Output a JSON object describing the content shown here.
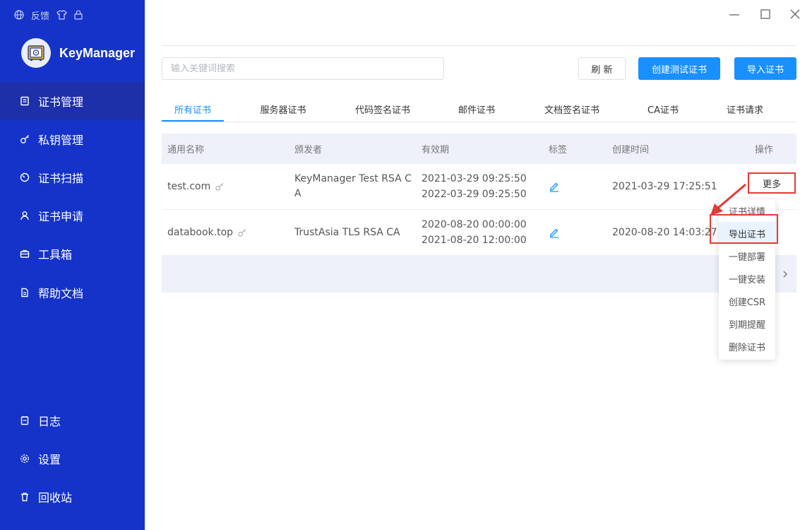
{
  "header": {
    "feedback_label": "反馈",
    "app_name": "KeyManager"
  },
  "sidebar": {
    "items": [
      {
        "label": "证书管理",
        "icon": "certificate-icon",
        "active": true
      },
      {
        "label": "私钥管理",
        "icon": "key-icon"
      },
      {
        "label": "证书扫描",
        "icon": "scan-icon"
      },
      {
        "label": "证书申请",
        "icon": "user-icon"
      },
      {
        "label": "工具箱",
        "icon": "toolbox-icon"
      },
      {
        "label": "帮助文档",
        "icon": "document-icon"
      }
    ],
    "bottom_items": [
      {
        "label": "日志",
        "icon": "log-icon"
      },
      {
        "label": "设置",
        "icon": "gear-icon"
      },
      {
        "label": "回收站",
        "icon": "trash-icon"
      }
    ]
  },
  "toolbar": {
    "search_placeholder": "输入关键词搜索",
    "refresh_label": "刷 新",
    "create_test_label": "创建测试证书",
    "import_label": "导入证书"
  },
  "tabs": [
    {
      "label": "所有证书",
      "active": true
    },
    {
      "label": "服务器证书"
    },
    {
      "label": "代码签名证书"
    },
    {
      "label": "邮件证书"
    },
    {
      "label": "文档签名证书"
    },
    {
      "label": "CA证书"
    },
    {
      "label": "证书请求"
    }
  ],
  "table": {
    "headers": {
      "common_name": "通用名称",
      "issuer": "颁发者",
      "validity": "有效期",
      "tags": "标签",
      "created": "创建时间",
      "actions": "操作"
    },
    "rows": [
      {
        "common_name": "test.com",
        "issuer": "KeyManager Test RSA CA",
        "valid_from": "2021-03-29 09:25:50",
        "valid_to": "2022-03-29 09:25:50",
        "created": "2021-03-29 17:25:51"
      },
      {
        "common_name": "databook.top",
        "issuer": "TrustAsia TLS RSA CA",
        "valid_from": "2020-08-20 00:00:00",
        "valid_to": "2021-08-20 12:00:00",
        "created": "2020-08-20 14:03:27"
      }
    ],
    "more_label": "更多"
  },
  "dropdown": {
    "items": [
      "证书详情",
      "导出证书",
      "一键部署",
      "一键安装",
      "创建CSR",
      "到期提醒",
      "删除证书"
    ],
    "highlighted": "导出证书"
  },
  "colors": {
    "sidebar": "#1533c9",
    "sidebar_active": "#1d2fa9",
    "primary": "#1890ff",
    "annotation": "#e53935"
  }
}
